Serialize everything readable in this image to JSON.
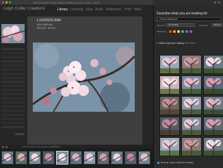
{
  "window": {
    "title": "Lightroom Classic Catalog - Adobe Photoshop Lightroom Classic - Library"
  },
  "identity": {
    "logo": "Leigh Collier Creations"
  },
  "modules": [
    "Library",
    "Develop",
    "Map",
    "Book",
    "Slideshow",
    "Print",
    "Web"
  ],
  "photo_info": {
    "name": "L1050926.RAF",
    "line2": "f/5.6 1/800 sec",
    "line3": "ISO 200 · 56 mm"
  },
  "left_panel": {
    "sections": [
      "Navigator",
      "Catalog",
      "Folders",
      "Collections",
      "Publish Services"
    ]
  },
  "toolbar": {
    "text": "All Photographs  1 of 1 selected / L1050926.RAF"
  },
  "app": {
    "heading": "Describe what you are looking for",
    "search_value": "Cherry Blossoms",
    "search_in_label": "Search in",
    "search_in_value": "All Catalogs",
    "tolerance_label": "Tolerance",
    "tolerance_value": "Medium",
    "filter_label": "Filtered by",
    "results_header": "Carlton Lightroom Catalog",
    "results_count": "360 results",
    "status": "Running: Carlton Lightroom Catalog"
  },
  "colors": {
    "accent": "#3fb4ff",
    "filter_chips": [
      "#e24a3b",
      "#f0a030",
      "#e8d83a",
      "#59b84a",
      "#3a8fe0",
      "#9a55c8"
    ]
  }
}
